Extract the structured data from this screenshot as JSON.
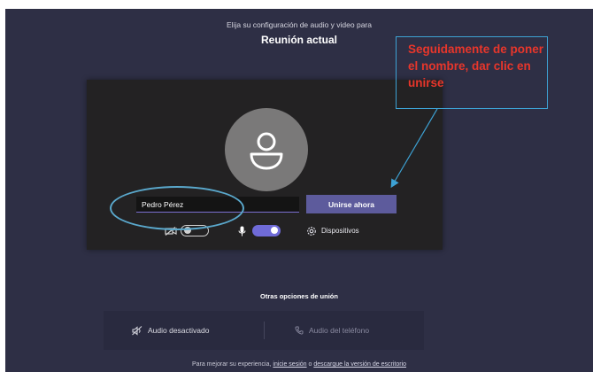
{
  "header": {
    "subtitle": "Elija su configuración de audio y video para",
    "title": "Reunión actual"
  },
  "preview": {
    "name_value": "Pedro Pérez",
    "join_label": "Unirse ahora",
    "camera_enabled": false,
    "mic_enabled": true,
    "devices_label": "Dispositivos"
  },
  "annotation": {
    "text": "Seguidamente de poner el nombre, dar clic en unirse",
    "color": "#e8362b",
    "outline_color": "#3da2d4"
  },
  "other_options": {
    "title": "Otras opciones de unión",
    "audio_off_label": "Audio desactivado",
    "phone_audio_label": "Audio del teléfono"
  },
  "footer": {
    "prefix": "Para mejorar su experiencia,",
    "signin_link": "inicie sesión",
    "middle": "o",
    "download_link": "descargue la versión de escritorio"
  },
  "colors": {
    "background": "#2e2f45",
    "accent": "#6f6bd8",
    "join_button": "#5d5b9c"
  }
}
